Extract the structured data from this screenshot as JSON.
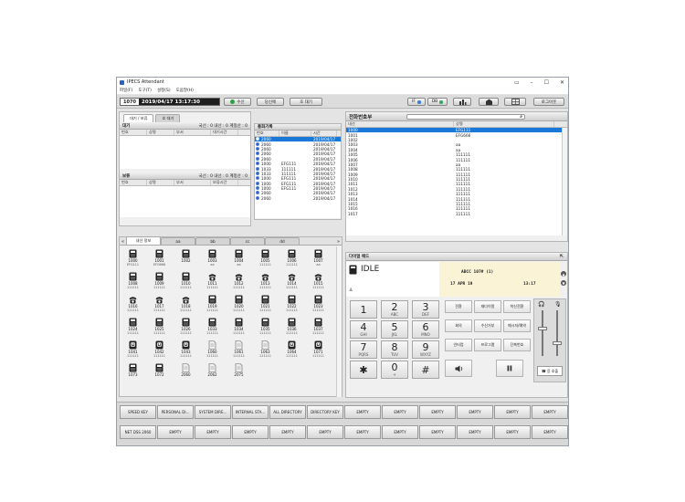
{
  "window": {
    "title": "IPECS Attendant"
  },
  "menu": [
    "파일(F)",
    "도구(T)",
    "설정(S)",
    "도움말(H)"
  ],
  "toolbar": {
    "ext_number": "1070",
    "clock": "2019/04/17 13:17:30",
    "connect_label": "수신",
    "btn2": "당신에",
    "btn3": "호 대기",
    "if_label": "IF",
    "db_label": "DB",
    "logout_label": "로그아웃"
  },
  "queue": {
    "tabs": [
      "대기 / 보류",
      "호 대기"
    ],
    "wait_title": "대기",
    "wait_counts": "국선 : 0  내선 : 0  계정산 : 0",
    "wait_cols": [
      "번호",
      "상명",
      "부서",
      "대기시간"
    ],
    "hold_title": "보류",
    "hold_counts": "국선 : 0  내선 : 0  계정산 : 0",
    "hold_cols": [
      "번호",
      "상명",
      "부서",
      "보류시간"
    ]
  },
  "history": {
    "title": "통화기록",
    "cols": [
      "번호",
      "이름",
      "시간"
    ],
    "rows": [
      {
        "num": "2060",
        "name": "",
        "time": "2019/04/17",
        "sel": true
      },
      {
        "num": "2060",
        "name": "",
        "time": "2019/04/17",
        "sel": false
      },
      {
        "num": "2060",
        "name": "",
        "time": "2019/04/17",
        "sel": false
      },
      {
        "num": "2060",
        "name": "",
        "time": "2019/04/17",
        "sel": false
      },
      {
        "num": "2060",
        "name": "",
        "time": "2019/04/17",
        "sel": false
      },
      {
        "num": "1000",
        "name": "EFG111",
        "time": "2019/04/17",
        "sel": false
      },
      {
        "num": "1033",
        "name": "111111",
        "time": "2019/04/17",
        "sel": false
      },
      {
        "num": "1033",
        "name": "111111",
        "time": "2019/04/17",
        "sel": false
      },
      {
        "num": "1000",
        "name": "EFG111",
        "time": "2019/04/17",
        "sel": false
      },
      {
        "num": "1000",
        "name": "EFG111",
        "time": "2019/04/17",
        "sel": false
      },
      {
        "num": "1000",
        "name": "EFG111",
        "time": "2019/04/17",
        "sel": false
      },
      {
        "num": "2060",
        "name": "",
        "time": "2019/04/17",
        "sel": false
      },
      {
        "num": "2060",
        "name": "",
        "time": "2019/04/17",
        "sel": false
      }
    ]
  },
  "phonebook": {
    "title": "전화번호부",
    "cols": [
      "내선",
      "상명"
    ],
    "rows": [
      {
        "ext": "1000",
        "name": "EFG111",
        "sel": true
      },
      {
        "ext": "1001",
        "name": "EFG666",
        "sel": false
      },
      {
        "ext": "1002",
        "name": "",
        "sel": false
      },
      {
        "ext": "1003",
        "name": "aa",
        "sel": false
      },
      {
        "ext": "1004",
        "name": "aa",
        "sel": false
      },
      {
        "ext": "1005",
        "name": "111111",
        "sel": false
      },
      {
        "ext": "1006",
        "name": "111111",
        "sel": false
      },
      {
        "ext": "1007",
        "name": "aa",
        "sel": false
      },
      {
        "ext": "1008",
        "name": "111111",
        "sel": false
      },
      {
        "ext": "1009",
        "name": "111111",
        "sel": false
      },
      {
        "ext": "1010",
        "name": "111111",
        "sel": false
      },
      {
        "ext": "1011",
        "name": "111111",
        "sel": false
      },
      {
        "ext": "1012",
        "name": "111111",
        "sel": false
      },
      {
        "ext": "1013",
        "name": "111111",
        "sel": false
      },
      {
        "ext": "1014",
        "name": "111111",
        "sel": false
      },
      {
        "ext": "1015",
        "name": "111111",
        "sel": false
      },
      {
        "ext": "1016",
        "name": "111111",
        "sel": false
      },
      {
        "ext": "1017",
        "name": "111111",
        "sel": false
      }
    ]
  },
  "dss": {
    "tabs": [
      "내선 정보",
      "aa",
      "bb",
      "cc",
      "dd"
    ],
    "items": [
      {
        "num": "1000",
        "sub": "EFG111",
        "kind": "desk"
      },
      {
        "num": "1001",
        "sub": "EFG666",
        "kind": "desk"
      },
      {
        "num": "1002",
        "sub": "",
        "kind": "desk"
      },
      {
        "num": "1003",
        "sub": "aa",
        "kind": "desk"
      },
      {
        "num": "1004",
        "sub": "aa",
        "kind": "desk"
      },
      {
        "num": "1005",
        "sub": "111111",
        "kind": "desk"
      },
      {
        "num": "1006",
        "sub": "111111",
        "kind": "desk"
      },
      {
        "num": "1007",
        "sub": "aa",
        "kind": "desk"
      },
      {
        "num": "1008",
        "sub": "111111",
        "kind": "desk"
      },
      {
        "num": "1009",
        "sub": "111111",
        "kind": "desk"
      },
      {
        "num": "1010",
        "sub": "111111",
        "kind": "desk"
      },
      {
        "num": "1011",
        "sub": "111111",
        "kind": "analog"
      },
      {
        "num": "1012",
        "sub": "111111",
        "kind": "analog"
      },
      {
        "num": "1013",
        "sub": "111111",
        "kind": "analog"
      },
      {
        "num": "1014",
        "sub": "111111",
        "kind": "analog"
      },
      {
        "num": "1015",
        "sub": "111111",
        "kind": "analog"
      },
      {
        "num": "1016",
        "sub": "111111",
        "kind": "analog"
      },
      {
        "num": "1017",
        "sub": "111111",
        "kind": "analog"
      },
      {
        "num": "1018",
        "sub": "111111",
        "kind": "analog"
      },
      {
        "num": "1019",
        "sub": "111111",
        "kind": "desk"
      },
      {
        "num": "1020",
        "sub": "111111",
        "kind": "desk"
      },
      {
        "num": "1021",
        "sub": "111111",
        "kind": "desk"
      },
      {
        "num": "1022",
        "sub": "111111",
        "kind": "desk"
      },
      {
        "num": "1023",
        "sub": "111111",
        "kind": "desk"
      },
      {
        "num": "1024",
        "sub": "111111",
        "kind": "desk"
      },
      {
        "num": "1025",
        "sub": "111111",
        "kind": "desk"
      },
      {
        "num": "1026",
        "sub": "111111",
        "kind": "desk"
      },
      {
        "num": "1033",
        "sub": "111111",
        "kind": "desk"
      },
      {
        "num": "1034",
        "sub": "111111",
        "kind": "desk"
      },
      {
        "num": "1035",
        "sub": "111111",
        "kind": "desk"
      },
      {
        "num": "1036",
        "sub": "111111",
        "kind": "desk"
      },
      {
        "num": "1037",
        "sub": "111111",
        "kind": "desk"
      },
      {
        "num": "1041",
        "sub": "111111",
        "kind": "uc"
      },
      {
        "num": "1042",
        "sub": "111111",
        "kind": "uc"
      },
      {
        "num": "1043",
        "sub": "111111",
        "kind": "uc"
      },
      {
        "num": "1060",
        "sub": "111111",
        "kind": "doc"
      },
      {
        "num": "1061",
        "sub": "111111",
        "kind": "doc"
      },
      {
        "num": "1063",
        "sub": "111111",
        "kind": "doc"
      },
      {
        "num": "1064",
        "sub": "111111",
        "kind": "uc"
      },
      {
        "num": "1071",
        "sub": "111111",
        "kind": "uc"
      },
      {
        "num": "1073",
        "sub": "",
        "kind": "desk"
      },
      {
        "num": "1072",
        "sub": "",
        "kind": "desk"
      },
      {
        "num": "2060",
        "sub": "",
        "kind": "doc"
      },
      {
        "num": "2062",
        "sub": "",
        "kind": "doc"
      },
      {
        "num": "2075",
        "sub": "",
        "kind": "doc"
      }
    ]
  },
  "dialpad": {
    "title": "다이얼 패드",
    "status": "IDLE",
    "lcd_line1": "ABCC   107# (1)",
    "lcd_date": "17 APR 19",
    "lcd_time": "13:17",
    "keys": [
      {
        "d": "1",
        "l": ""
      },
      {
        "d": "2",
        "l": "ABC"
      },
      {
        "d": "3",
        "l": "DEF"
      },
      {
        "d": "4",
        "l": "GHI"
      },
      {
        "d": "5",
        "l": "JKL"
      },
      {
        "d": "6",
        "l": "MNO"
      },
      {
        "d": "7",
        "l": "PQRS"
      },
      {
        "d": "8",
        "l": "TUV"
      },
      {
        "d": "9",
        "l": "WXYZ"
      },
      {
        "d": "✱",
        "l": ""
      },
      {
        "d": "0",
        "l": "+"
      },
      {
        "d": "#",
        "l": ""
      }
    ],
    "softkeys": [
      "전환",
      "재다이얼",
      "착신전환",
      "회의",
      "수신거부",
      "메시지/예약",
      "인터컴",
      "프로그램",
      "단축번호"
    ],
    "call_label": "응 호출"
  },
  "bottom_keys": {
    "row1": [
      "SPEED KEY",
      "PERSONAL DI...",
      "SYSTEM DIRE...",
      "INTERNAL STA...",
      "ALL DIRECTORY",
      "DIRECTORY KEY",
      "EMPTY",
      "EMPTY",
      "EMPTY",
      "EMPTY",
      "EMPTY",
      "EMPTY"
    ],
    "row2": [
      "NET DSS 2060",
      "EMPTY",
      "EMPTY",
      "EMPTY",
      "EMPTY",
      "EMPTY",
      "EMPTY",
      "EMPTY",
      "EMPTY",
      "EMPTY",
      "EMPTY",
      "EMPTY"
    ]
  },
  "colors": {
    "accent": "#1a78d8",
    "dark": "#1e1e1e",
    "ok": "#2ea043"
  }
}
